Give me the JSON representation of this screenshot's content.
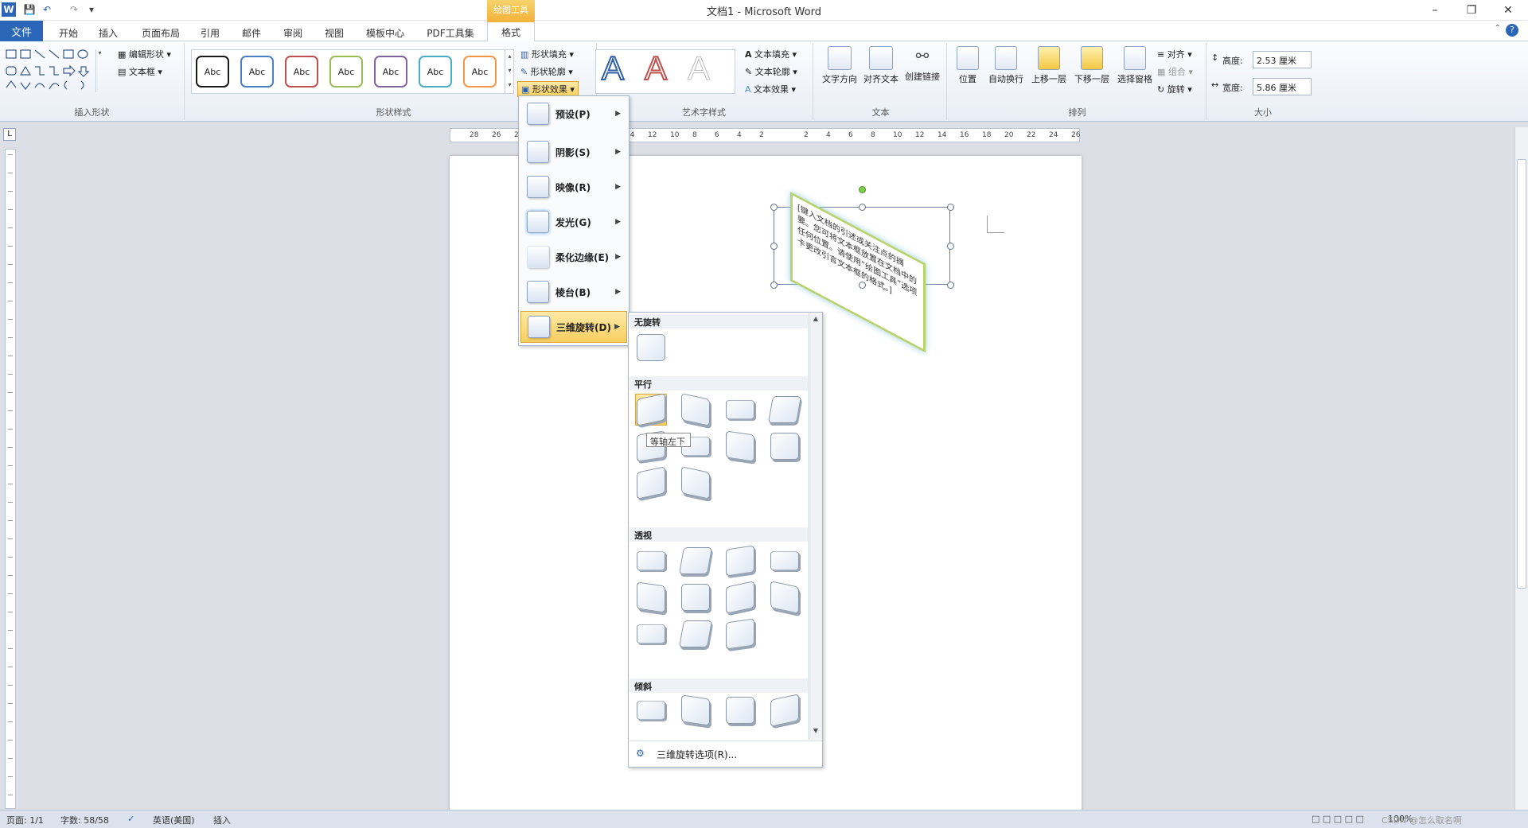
{
  "app": {
    "title": "文档1  -  Microsoft Word"
  },
  "context_tab": {
    "label": "绘图工具"
  },
  "tabs": {
    "file": "文件",
    "home": "开始",
    "insert": "插入",
    "layout": "页面布局",
    "references": "引用",
    "mailings": "邮件",
    "review": "审阅",
    "view": "视图",
    "templates": "模板中心",
    "pdf": "PDF工具集",
    "format": "格式"
  },
  "ribbon": {
    "insert_shapes": {
      "label": "插入形状",
      "edit_shape": "编辑形状",
      "text_box": "文本框"
    },
    "shape_styles": {
      "label": "形状样式",
      "sample": "Abc",
      "fill": "形状填充",
      "outline": "形状轮廓",
      "effects": "形状效果",
      "colors": [
        "#1a1a1a",
        "#4a7fc1",
        "#c0504d",
        "#9bbb59",
        "#8064a2",
        "#4bacc6",
        "#f79646"
      ]
    },
    "wordart": {
      "label": "艺术字样式",
      "fill": "文本填充",
      "outline": "文本轮廓",
      "effects": "文本效果",
      "letter": "A"
    },
    "text": {
      "label": "文本",
      "direction": "文字方向",
      "align": "对齐文本",
      "link": "创建链接"
    },
    "arrange": {
      "label": "排列",
      "position": "位置",
      "wrap": "自动换行",
      "forward": "上移一层",
      "backward": "下移一层",
      "pane": "选择窗格",
      "align": "对齐",
      "group": "组合",
      "rotate": "旋转"
    },
    "size": {
      "label": "大小",
      "height_label": "高度:",
      "height": "2.53 厘米",
      "width_label": "宽度:",
      "width": "5.86 厘米"
    }
  },
  "ruler": {
    "ticks": [
      "28",
      "26",
      "24",
      "22",
      "20",
      "18",
      "16",
      "14",
      "12",
      "10",
      "8",
      "6",
      "4",
      "2",
      "",
      "2",
      "4",
      "6",
      "8",
      "10",
      "12",
      "14",
      "16",
      "18",
      "20",
      "22",
      "24",
      "26"
    ]
  },
  "effects_menu": {
    "items": [
      {
        "label": "预设(P)"
      },
      {
        "label": "阴影(S)"
      },
      {
        "label": "映像(R)"
      },
      {
        "label": "发光(G)"
      },
      {
        "label": "柔化边缘(E)"
      },
      {
        "label": "棱台(B)"
      },
      {
        "label": "三维旋转(D)"
      }
    ]
  },
  "rotation_gallery": {
    "sections": {
      "none": "无旋转",
      "parallel": "平行",
      "perspective": "透视",
      "oblique": "倾斜"
    },
    "tooltip": "等轴左下",
    "options": "三维旋转选项(R)..."
  },
  "document": {
    "textbox_text": "[键入文档的引述或关注点的摘要。您可将文本框放置在文档中的任何位置。请使用“绘图工具”选项卡更改引言文本框的格式。]"
  },
  "status": {
    "page": "页面: 1/1",
    "words": "字数: 58/58",
    "lang": "英语(美国)",
    "mode": "插入",
    "zoom": "100%",
    "watermark": "CSDN @怎么取名啊"
  }
}
